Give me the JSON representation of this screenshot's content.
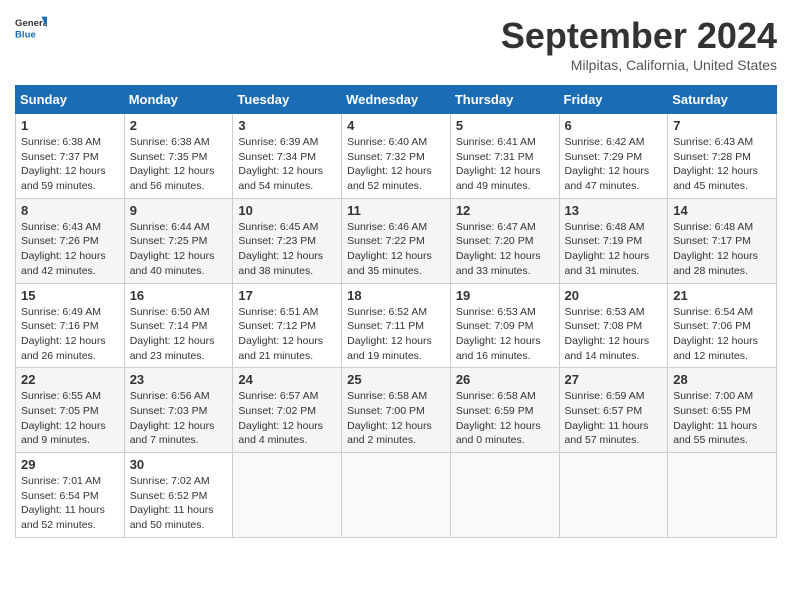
{
  "logo": {
    "line1": "General",
    "line2": "Blue"
  },
  "title": "September 2024",
  "subtitle": "Milpitas, California, United States",
  "weekdays": [
    "Sunday",
    "Monday",
    "Tuesday",
    "Wednesday",
    "Thursday",
    "Friday",
    "Saturday"
  ],
  "weeks": [
    [
      {
        "day": "1",
        "info": "Sunrise: 6:38 AM\nSunset: 7:37 PM\nDaylight: 12 hours\nand 59 minutes."
      },
      {
        "day": "2",
        "info": "Sunrise: 6:38 AM\nSunset: 7:35 PM\nDaylight: 12 hours\nand 56 minutes."
      },
      {
        "day": "3",
        "info": "Sunrise: 6:39 AM\nSunset: 7:34 PM\nDaylight: 12 hours\nand 54 minutes."
      },
      {
        "day": "4",
        "info": "Sunrise: 6:40 AM\nSunset: 7:32 PM\nDaylight: 12 hours\nand 52 minutes."
      },
      {
        "day": "5",
        "info": "Sunrise: 6:41 AM\nSunset: 7:31 PM\nDaylight: 12 hours\nand 49 minutes."
      },
      {
        "day": "6",
        "info": "Sunrise: 6:42 AM\nSunset: 7:29 PM\nDaylight: 12 hours\nand 47 minutes."
      },
      {
        "day": "7",
        "info": "Sunrise: 6:43 AM\nSunset: 7:28 PM\nDaylight: 12 hours\nand 45 minutes."
      }
    ],
    [
      {
        "day": "8",
        "info": "Sunrise: 6:43 AM\nSunset: 7:26 PM\nDaylight: 12 hours\nand 42 minutes."
      },
      {
        "day": "9",
        "info": "Sunrise: 6:44 AM\nSunset: 7:25 PM\nDaylight: 12 hours\nand 40 minutes."
      },
      {
        "day": "10",
        "info": "Sunrise: 6:45 AM\nSunset: 7:23 PM\nDaylight: 12 hours\nand 38 minutes."
      },
      {
        "day": "11",
        "info": "Sunrise: 6:46 AM\nSunset: 7:22 PM\nDaylight: 12 hours\nand 35 minutes."
      },
      {
        "day": "12",
        "info": "Sunrise: 6:47 AM\nSunset: 7:20 PM\nDaylight: 12 hours\nand 33 minutes."
      },
      {
        "day": "13",
        "info": "Sunrise: 6:48 AM\nSunset: 7:19 PM\nDaylight: 12 hours\nand 31 minutes."
      },
      {
        "day": "14",
        "info": "Sunrise: 6:48 AM\nSunset: 7:17 PM\nDaylight: 12 hours\nand 28 minutes."
      }
    ],
    [
      {
        "day": "15",
        "info": "Sunrise: 6:49 AM\nSunset: 7:16 PM\nDaylight: 12 hours\nand 26 minutes."
      },
      {
        "day": "16",
        "info": "Sunrise: 6:50 AM\nSunset: 7:14 PM\nDaylight: 12 hours\nand 23 minutes."
      },
      {
        "day": "17",
        "info": "Sunrise: 6:51 AM\nSunset: 7:12 PM\nDaylight: 12 hours\nand 21 minutes."
      },
      {
        "day": "18",
        "info": "Sunrise: 6:52 AM\nSunset: 7:11 PM\nDaylight: 12 hours\nand 19 minutes."
      },
      {
        "day": "19",
        "info": "Sunrise: 6:53 AM\nSunset: 7:09 PM\nDaylight: 12 hours\nand 16 minutes."
      },
      {
        "day": "20",
        "info": "Sunrise: 6:53 AM\nSunset: 7:08 PM\nDaylight: 12 hours\nand 14 minutes."
      },
      {
        "day": "21",
        "info": "Sunrise: 6:54 AM\nSunset: 7:06 PM\nDaylight: 12 hours\nand 12 minutes."
      }
    ],
    [
      {
        "day": "22",
        "info": "Sunrise: 6:55 AM\nSunset: 7:05 PM\nDaylight: 12 hours\nand 9 minutes."
      },
      {
        "day": "23",
        "info": "Sunrise: 6:56 AM\nSunset: 7:03 PM\nDaylight: 12 hours\nand 7 minutes."
      },
      {
        "day": "24",
        "info": "Sunrise: 6:57 AM\nSunset: 7:02 PM\nDaylight: 12 hours\nand 4 minutes."
      },
      {
        "day": "25",
        "info": "Sunrise: 6:58 AM\nSunset: 7:00 PM\nDaylight: 12 hours\nand 2 minutes."
      },
      {
        "day": "26",
        "info": "Sunrise: 6:58 AM\nSunset: 6:59 PM\nDaylight: 12 hours\nand 0 minutes."
      },
      {
        "day": "27",
        "info": "Sunrise: 6:59 AM\nSunset: 6:57 PM\nDaylight: 11 hours\nand 57 minutes."
      },
      {
        "day": "28",
        "info": "Sunrise: 7:00 AM\nSunset: 6:55 PM\nDaylight: 11 hours\nand 55 minutes."
      }
    ],
    [
      {
        "day": "29",
        "info": "Sunrise: 7:01 AM\nSunset: 6:54 PM\nDaylight: 11 hours\nand 52 minutes."
      },
      {
        "day": "30",
        "info": "Sunrise: 7:02 AM\nSunset: 6:52 PM\nDaylight: 11 hours\nand 50 minutes."
      },
      {
        "day": "",
        "info": ""
      },
      {
        "day": "",
        "info": ""
      },
      {
        "day": "",
        "info": ""
      },
      {
        "day": "",
        "info": ""
      },
      {
        "day": "",
        "info": ""
      }
    ]
  ]
}
